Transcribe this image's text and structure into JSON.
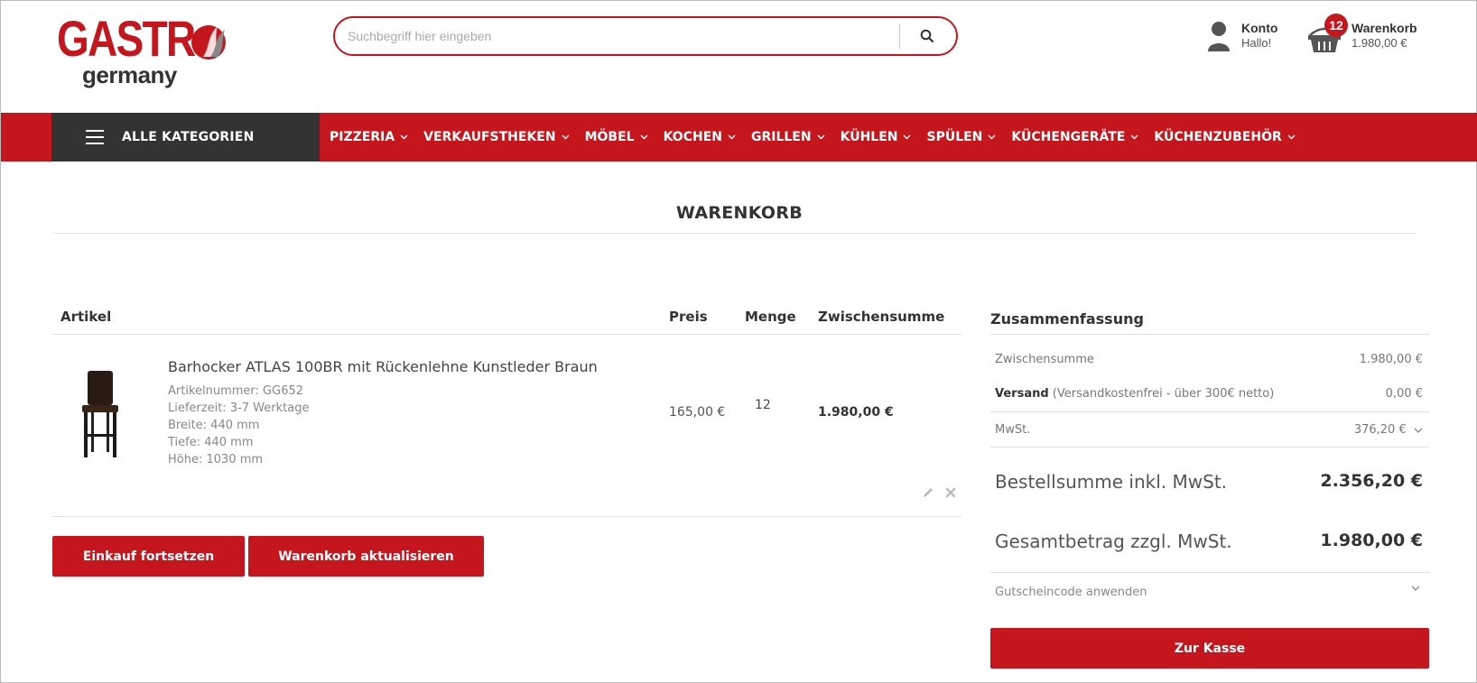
{
  "header": {
    "logo_top": "GASTR",
    "logo_bottom": "germany",
    "search_placeholder": "Suchbegriff hier eingeben",
    "account_title": "Konto",
    "account_greeting": "Hallo!",
    "cart_count": "12",
    "cart_title": "Warenkorb",
    "cart_total": "1.980,00 €"
  },
  "nav": {
    "all_categories": "ALLE KATEGORIEN",
    "items": [
      "PIZZERIA",
      "VERKAUFSTHEKEN",
      "MÖBEL",
      "KOCHEN",
      "GRILLEN",
      "KÜHLEN",
      "SPÜLEN",
      "KÜCHENGERÄTE",
      "KÜCHENZUBEHÖR"
    ]
  },
  "page": {
    "title": "WARENKORB"
  },
  "cart_table": {
    "headers": {
      "article": "Artikel",
      "price": "Preis",
      "qty": "Menge",
      "subtotal": "Zwischensumme"
    },
    "items": [
      {
        "name": "Barhocker ATLAS 100BR mit Rückenlehne Kunstleder Braun",
        "meta": [
          "Artikelnummer: GG652",
          "Lieferzeit: 3-7 Werktage",
          "Breite: 440 mm",
          "Tiefe: 440 mm",
          "Höhe: 1030 mm"
        ],
        "price": "165,00 €",
        "qty": "12",
        "subtotal": "1.980,00 €"
      }
    ]
  },
  "buttons": {
    "continue": "Einkauf fortsetzen",
    "update": "Warenkorb aktualisieren",
    "checkout": "Zur Kasse"
  },
  "summary": {
    "title": "Zusammenfassung",
    "subtotal_label": "Zwischensumme",
    "subtotal_value": "1.980,00 €",
    "shipping_label": "Versand",
    "shipping_note": " (Versandkostenfrei - über 300€ netto)",
    "shipping_value": "0,00 €",
    "tax_label": "MwSt.",
    "tax_value": "376,20 €",
    "order_total_label": "Bestellsumme inkl. MwSt.",
    "order_total_value": "2.356,20 €",
    "net_total_label": "Gesamtbetrag zzgl. MwSt.",
    "net_total_value": "1.980,00 €",
    "coupon_label": "Gutscheincode anwenden"
  },
  "colors": {
    "brand_red": "#c4161c",
    "dark": "#333333"
  }
}
